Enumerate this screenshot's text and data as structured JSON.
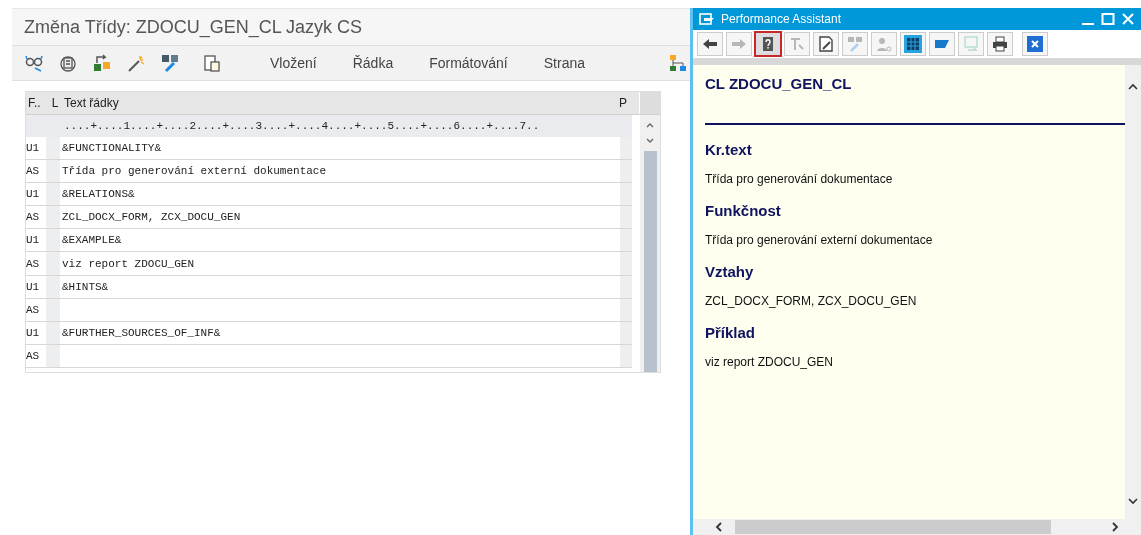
{
  "window": {
    "title": "Změna Třídy: ZDOCU_GEN_CL Jazyk CS"
  },
  "toolbar": {
    "icons": [
      {
        "kind": "glasses"
      },
      {
        "kind": "stack"
      },
      {
        "kind": "transport"
      },
      {
        "kind": "wand"
      },
      {
        "kind": "edit"
      },
      {
        "kind": "clipboard"
      }
    ],
    "menus": [
      "Vložení",
      "Řádka",
      "Formátování",
      "Strana"
    ]
  },
  "editor": {
    "columns": [
      "F..",
      "L",
      "Text řádky",
      "P"
    ],
    "ruler": "....+....1....+....2....+....3....+....4....+....5....+....6....+....7..",
    "rows": [
      {
        "format": "U1",
        "text": "&FUNCTIONALITY&"
      },
      {
        "format": "AS",
        "text": "Třída pro generování externí dokumentace"
      },
      {
        "format": "U1",
        "text": "&RELATIONS&"
      },
      {
        "format": "AS",
        "text": "ZCL_DOCX_FORM, ZCX_DOCU_GEN"
      },
      {
        "format": "U1",
        "text": "&EXAMPLE&"
      },
      {
        "format": "AS",
        "text": "viz report ZDOCU_GEN"
      },
      {
        "format": "U1",
        "text": "&HINTS&"
      },
      {
        "format": "AS",
        "text": ""
      },
      {
        "format": "U1",
        "text": "&FURTHER_SOURCES_OF_INF&"
      },
      {
        "format": "AS",
        "text": ""
      }
    ]
  },
  "assistant": {
    "title": "Performance Assistant",
    "toolbar": [
      {
        "kind": "back",
        "disabled": false,
        "selected": false
      },
      {
        "kind": "forward",
        "disabled": true,
        "selected": false
      },
      {
        "kind": "help",
        "disabled": false,
        "selected": true
      },
      {
        "kind": "tool",
        "disabled": true,
        "selected": false
      },
      {
        "kind": "edit",
        "disabled": false,
        "selected": false
      },
      {
        "kind": "wand",
        "disabled": true,
        "selected": false
      },
      {
        "kind": "user",
        "disabled": true,
        "selected": false
      },
      {
        "kind": "calendar",
        "disabled": false,
        "selected": false
      },
      {
        "kind": "flag",
        "disabled": false,
        "selected": false
      },
      {
        "kind": "export",
        "disabled": true,
        "selected": false
      },
      {
        "kind": "print",
        "disabled": false,
        "selected": false
      },
      {
        "kind": "close",
        "disabled": false,
        "selected": false
      }
    ],
    "heading": "CL ZDOCU_GEN_CL",
    "sections": [
      {
        "heading": "Kr.text",
        "body": "Třída pro generování dokumentace"
      },
      {
        "heading": "Funkčnost",
        "body": "Třída pro generování externí dokumentace"
      },
      {
        "heading": "Vztahy",
        "body": "ZCL_DOCX_FORM, ZCX_DOCU_GEN"
      },
      {
        "heading": "Příklad",
        "body": "viz report ZDOCU_GEN"
      }
    ]
  }
}
